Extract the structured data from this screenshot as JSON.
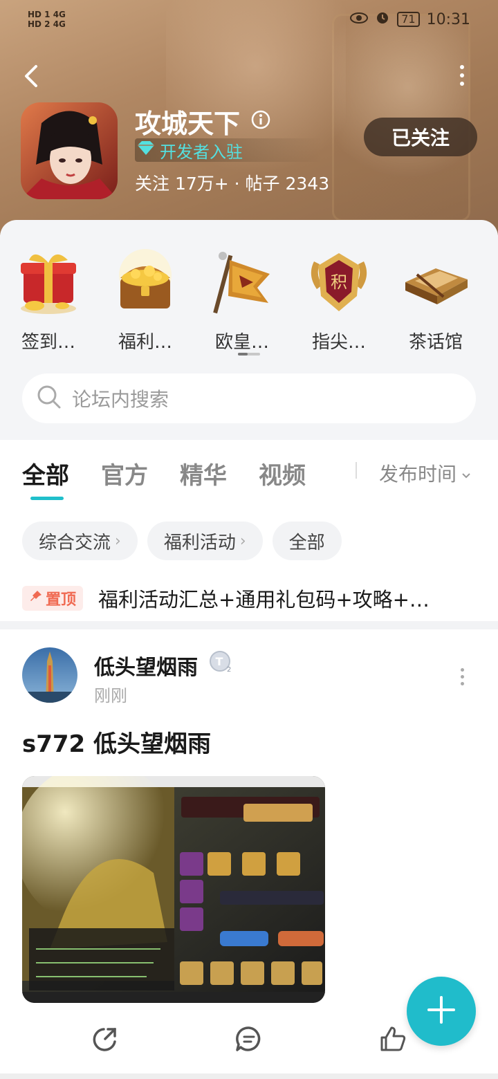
{
  "status_bar": {
    "left_top": "HD 1  4G",
    "left_bottom": "HD 2  4G",
    "battery": "71",
    "time": "10:31"
  },
  "forum": {
    "title": "攻城天下",
    "developer_badge": "开发者入驻",
    "stats": "关注 17万+ · 帖子 2343",
    "follow_label": "已关注"
  },
  "quick_links": [
    {
      "label": "签到…",
      "icon": "gift-icon"
    },
    {
      "label": "福利…",
      "icon": "treasure-chest-icon"
    },
    {
      "label": "欧皇…",
      "icon": "war-flag-icon"
    },
    {
      "label": "指尖…",
      "icon": "emblem-icon"
    },
    {
      "label": "茶话馆",
      "icon": "book-icon"
    }
  ],
  "search": {
    "placeholder": "论坛内搜索"
  },
  "tabs": [
    "全部",
    "官方",
    "精华",
    "视频"
  ],
  "sort_label": "发布时间",
  "chips": [
    {
      "label": "综合交流",
      "has_arrow": true
    },
    {
      "label": "福利活动",
      "has_arrow": true
    },
    {
      "label": "全部",
      "has_arrow": false
    }
  ],
  "pinned": {
    "badge": "置顶",
    "title": "福利活动汇总+通用礼包码+攻略+…"
  },
  "post": {
    "username": "低头望烟雨",
    "time": "刚刚",
    "title": "s772 低头望烟雨"
  },
  "colors": {
    "accent": "#20bccb",
    "header": "#a07855",
    "pin": "#f06a52"
  }
}
